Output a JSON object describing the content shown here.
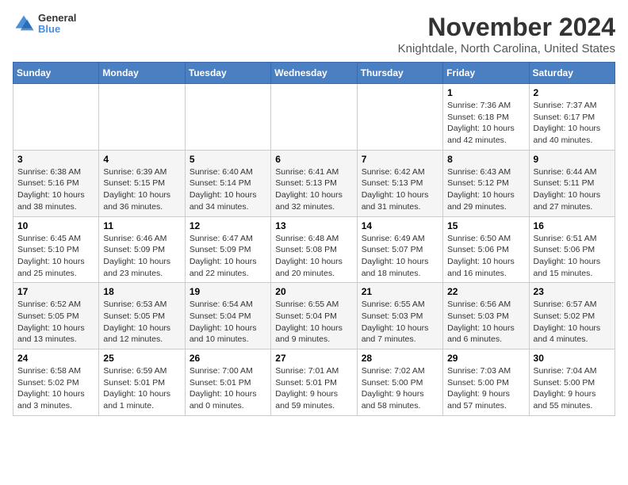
{
  "header": {
    "logo_line1": "General",
    "logo_line2": "Blue",
    "month": "November 2024",
    "location": "Knightdale, North Carolina, United States"
  },
  "weekdays": [
    "Sunday",
    "Monday",
    "Tuesday",
    "Wednesday",
    "Thursday",
    "Friday",
    "Saturday"
  ],
  "weeks": [
    [
      {
        "day": "",
        "info": ""
      },
      {
        "day": "",
        "info": ""
      },
      {
        "day": "",
        "info": ""
      },
      {
        "day": "",
        "info": ""
      },
      {
        "day": "",
        "info": ""
      },
      {
        "day": "1",
        "info": "Sunrise: 7:36 AM\nSunset: 6:18 PM\nDaylight: 10 hours\nand 42 minutes."
      },
      {
        "day": "2",
        "info": "Sunrise: 7:37 AM\nSunset: 6:17 PM\nDaylight: 10 hours\nand 40 minutes."
      }
    ],
    [
      {
        "day": "3",
        "info": "Sunrise: 6:38 AM\nSunset: 5:16 PM\nDaylight: 10 hours\nand 38 minutes."
      },
      {
        "day": "4",
        "info": "Sunrise: 6:39 AM\nSunset: 5:15 PM\nDaylight: 10 hours\nand 36 minutes."
      },
      {
        "day": "5",
        "info": "Sunrise: 6:40 AM\nSunset: 5:14 PM\nDaylight: 10 hours\nand 34 minutes."
      },
      {
        "day": "6",
        "info": "Sunrise: 6:41 AM\nSunset: 5:13 PM\nDaylight: 10 hours\nand 32 minutes."
      },
      {
        "day": "7",
        "info": "Sunrise: 6:42 AM\nSunset: 5:13 PM\nDaylight: 10 hours\nand 31 minutes."
      },
      {
        "day": "8",
        "info": "Sunrise: 6:43 AM\nSunset: 5:12 PM\nDaylight: 10 hours\nand 29 minutes."
      },
      {
        "day": "9",
        "info": "Sunrise: 6:44 AM\nSunset: 5:11 PM\nDaylight: 10 hours\nand 27 minutes."
      }
    ],
    [
      {
        "day": "10",
        "info": "Sunrise: 6:45 AM\nSunset: 5:10 PM\nDaylight: 10 hours\nand 25 minutes."
      },
      {
        "day": "11",
        "info": "Sunrise: 6:46 AM\nSunset: 5:09 PM\nDaylight: 10 hours\nand 23 minutes."
      },
      {
        "day": "12",
        "info": "Sunrise: 6:47 AM\nSunset: 5:09 PM\nDaylight: 10 hours\nand 22 minutes."
      },
      {
        "day": "13",
        "info": "Sunrise: 6:48 AM\nSunset: 5:08 PM\nDaylight: 10 hours\nand 20 minutes."
      },
      {
        "day": "14",
        "info": "Sunrise: 6:49 AM\nSunset: 5:07 PM\nDaylight: 10 hours\nand 18 minutes."
      },
      {
        "day": "15",
        "info": "Sunrise: 6:50 AM\nSunset: 5:06 PM\nDaylight: 10 hours\nand 16 minutes."
      },
      {
        "day": "16",
        "info": "Sunrise: 6:51 AM\nSunset: 5:06 PM\nDaylight: 10 hours\nand 15 minutes."
      }
    ],
    [
      {
        "day": "17",
        "info": "Sunrise: 6:52 AM\nSunset: 5:05 PM\nDaylight: 10 hours\nand 13 minutes."
      },
      {
        "day": "18",
        "info": "Sunrise: 6:53 AM\nSunset: 5:05 PM\nDaylight: 10 hours\nand 12 minutes."
      },
      {
        "day": "19",
        "info": "Sunrise: 6:54 AM\nSunset: 5:04 PM\nDaylight: 10 hours\nand 10 minutes."
      },
      {
        "day": "20",
        "info": "Sunrise: 6:55 AM\nSunset: 5:04 PM\nDaylight: 10 hours\nand 9 minutes."
      },
      {
        "day": "21",
        "info": "Sunrise: 6:55 AM\nSunset: 5:03 PM\nDaylight: 10 hours\nand 7 minutes."
      },
      {
        "day": "22",
        "info": "Sunrise: 6:56 AM\nSunset: 5:03 PM\nDaylight: 10 hours\nand 6 minutes."
      },
      {
        "day": "23",
        "info": "Sunrise: 6:57 AM\nSunset: 5:02 PM\nDaylight: 10 hours\nand 4 minutes."
      }
    ],
    [
      {
        "day": "24",
        "info": "Sunrise: 6:58 AM\nSunset: 5:02 PM\nDaylight: 10 hours\nand 3 minutes."
      },
      {
        "day": "25",
        "info": "Sunrise: 6:59 AM\nSunset: 5:01 PM\nDaylight: 10 hours\nand 1 minute."
      },
      {
        "day": "26",
        "info": "Sunrise: 7:00 AM\nSunset: 5:01 PM\nDaylight: 10 hours\nand 0 minutes."
      },
      {
        "day": "27",
        "info": "Sunrise: 7:01 AM\nSunset: 5:01 PM\nDaylight: 9 hours\nand 59 minutes."
      },
      {
        "day": "28",
        "info": "Sunrise: 7:02 AM\nSunset: 5:00 PM\nDaylight: 9 hours\nand 58 minutes."
      },
      {
        "day": "29",
        "info": "Sunrise: 7:03 AM\nSunset: 5:00 PM\nDaylight: 9 hours\nand 57 minutes."
      },
      {
        "day": "30",
        "info": "Sunrise: 7:04 AM\nSunset: 5:00 PM\nDaylight: 9 hours\nand 55 minutes."
      }
    ]
  ]
}
